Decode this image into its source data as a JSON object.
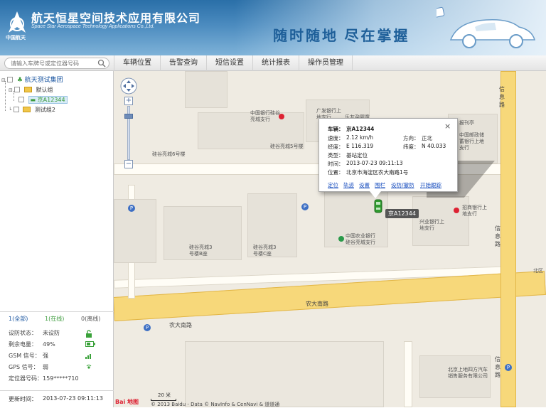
{
  "header": {
    "logo_text": "中国航天",
    "company_cn": "航天恒星空间技术应用有限公司",
    "company_en": "Space Star Aerospace Technology Applications Co.,Ltd.",
    "slogan": "随时随地 尽在掌握",
    "brand_color": "#2a6fa8"
  },
  "search": {
    "placeholder": "请输入车牌号或定位器号码",
    "icon": "search-icon"
  },
  "tabs": [
    "车辆位置",
    "告警查询",
    "短信设置",
    "统计报表",
    "操作员管理"
  ],
  "tree": {
    "root": "航天测试集团",
    "groups": [
      {
        "label": "默认组",
        "vehicles": [
          "京A12344"
        ]
      },
      {
        "label": "测试组2",
        "vehicles": []
      }
    ]
  },
  "counts": {
    "all": "1(全部)",
    "online": "1(在线)",
    "offline": "0(离线)"
  },
  "status": {
    "defense": {
      "label": "设防状态：",
      "value": "未设防",
      "icon": "unlock-icon"
    },
    "battery": {
      "label": "剩余电量：",
      "value": "49%",
      "icon": "battery-icon"
    },
    "gsm": {
      "label": "GSM 信号：",
      "value": "强",
      "icon": "signal-icon"
    },
    "gps": {
      "label": "GPS 信号：",
      "value": "弱",
      "icon": "gps-icon"
    },
    "locator": {
      "label": "定位器号码：",
      "value": "159*****710"
    }
  },
  "update": {
    "label": "更新时间：",
    "value": "2013-07-23 09:11:13"
  },
  "popup": {
    "plate_label": "车辆：",
    "plate": "京A12344",
    "speed_label": "速度：",
    "speed": "2.12 km/h",
    "heading_label": "方向：",
    "heading": "正北",
    "lng_label": "经度：",
    "lng": "E 116.319",
    "lat_label": "纬度：",
    "lat": "N 40.033",
    "type_label": "类型：",
    "type": "基站定位",
    "time_label": "时间：",
    "time": "2013-07-23 09:11:13",
    "loc_label": "位置：",
    "loc": "北京市海淀区农大南路1号",
    "actions": [
      "定位",
      "轨迹",
      "设置",
      "围栏",
      "设防/撤防",
      "开始跟踪"
    ],
    "close": "×"
  },
  "map": {
    "vehicle_label": "京A12344",
    "poi": [
      "中国银行硅谷亮城支行",
      "广发银行上地支行",
      "乐友孕婴童",
      "报刊亭",
      "中国邮政储蓄银行上地支行",
      "招商银行上地支行",
      "兴业银行上地支行",
      "中国农业银行硅谷亮城支行",
      "硅谷亮城3号楼B座",
      "硅谷亮城3号楼C座",
      "硅谷亮城6号楼",
      "硅谷亮城5号楼",
      "北京上地四方汽车销售服务有限公司",
      "北区"
    ],
    "roads": [
      "农大南路",
      "农大南路",
      "信息路",
      "信息路",
      "信息路"
    ],
    "scale": "20 米",
    "copyright": "© 2013 Baidu - Data © NavInfo & CenNavi & 道道通",
    "baidu": "Bai 地图"
  }
}
